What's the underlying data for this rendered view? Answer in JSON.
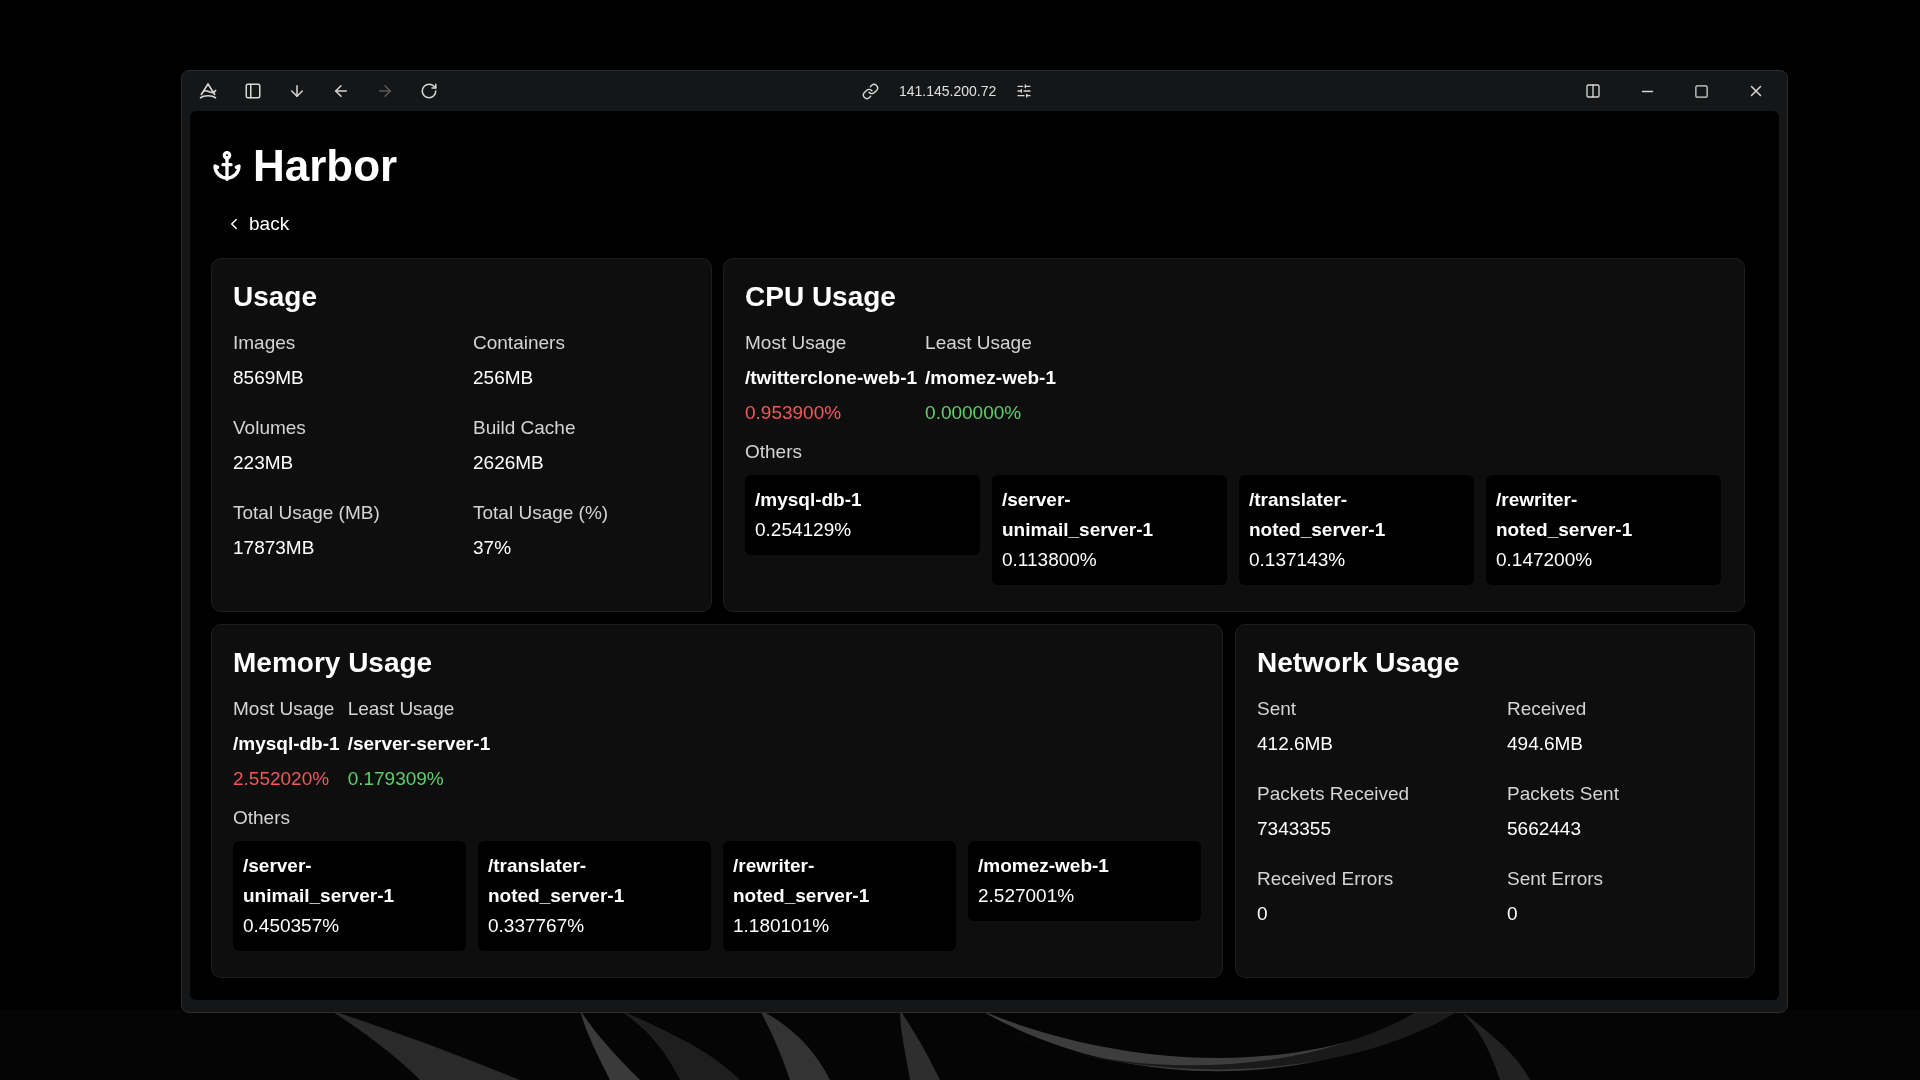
{
  "browser": {
    "address": "141.145.200.72",
    "forward_disabled": true
  },
  "app": {
    "title": "Harbor",
    "back": "back"
  },
  "usage": {
    "title": "Usage",
    "stats": [
      {
        "label": "Images",
        "value": "8569MB"
      },
      {
        "label": "Containers",
        "value": "256MB"
      },
      {
        "label": "Volumes",
        "value": "223MB"
      },
      {
        "label": "Build Cache",
        "value": "2626MB"
      },
      {
        "label": "Total Usage (MB)",
        "value": "17873MB"
      },
      {
        "label": "Total Usage (%)",
        "value": "37%"
      }
    ]
  },
  "cpu": {
    "title": "CPU Usage",
    "most": {
      "label": "Most Usage",
      "name": "/twitterclone-web-1",
      "value": "0.953900%"
    },
    "least": {
      "label": "Least Usage",
      "name": "/momez-web-1",
      "value": "0.000000%"
    },
    "others_label": "Others",
    "others": [
      {
        "name": "/mysql-db-1",
        "value": "0.254129%"
      },
      {
        "name": "/server-unimail_server-1",
        "value": "0.113800%"
      },
      {
        "name": "/translater-noted_server-1",
        "value": "0.137143%"
      },
      {
        "name": "/rewriter-noted_server-1",
        "value": "0.147200%"
      }
    ]
  },
  "memory": {
    "title": "Memory Usage",
    "most": {
      "label": "Most Usage",
      "name": "/mysql-db-1",
      "value": "2.552020%"
    },
    "least": {
      "label": "Least Usage",
      "name": "/server-server-1",
      "value": "0.179309%"
    },
    "others_label": "Others",
    "others": [
      {
        "name": "/server-unimail_server-1",
        "value": "0.450357%"
      },
      {
        "name": "/translater-noted_server-1",
        "value": "0.337767%"
      },
      {
        "name": "/rewriter-noted_server-1",
        "value": "1.180101%"
      },
      {
        "name": "/momez-web-1",
        "value": "2.527001%"
      }
    ]
  },
  "network": {
    "title": "Network Usage",
    "stats": [
      {
        "label": "Sent",
        "value": "412.6MB"
      },
      {
        "label": "Received",
        "value": "494.6MB"
      },
      {
        "label": "Packets Received",
        "value": "7343355"
      },
      {
        "label": "Packets Sent",
        "value": "5662443"
      },
      {
        "label": "Received Errors",
        "value": "0"
      },
      {
        "label": "Sent Errors",
        "value": "0"
      }
    ]
  }
}
